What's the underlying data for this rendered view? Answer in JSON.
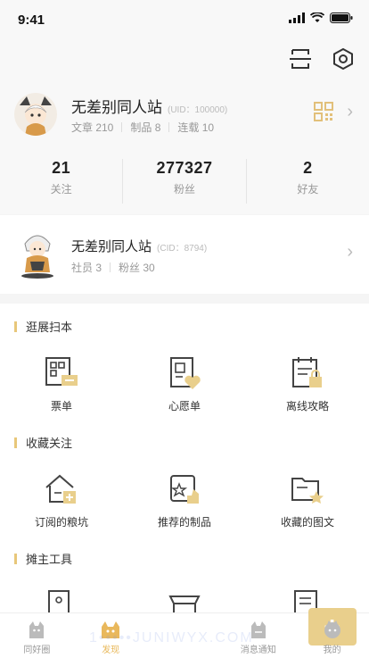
{
  "status_bar": {
    "time": "9:41"
  },
  "profile": {
    "name": "无差别同人站",
    "uid": "(UID：100000)",
    "articles": "文章 210",
    "products": "制品 8",
    "serials": "连载 10"
  },
  "stats": [
    {
      "num": "21",
      "label": "关注"
    },
    {
      "num": "277327",
      "label": "粉丝"
    },
    {
      "num": "2",
      "label": "好友"
    }
  ],
  "circle": {
    "name": "无差别同人站",
    "cid": "(CID：8794)",
    "members": "社员 3",
    "fans": "粉丝 30"
  },
  "sections": [
    {
      "title": "逛展扫本",
      "items": [
        {
          "label": "票单",
          "icon": "ticket-list-icon"
        },
        {
          "label": "心愿单",
          "icon": "wishlist-icon"
        },
        {
          "label": "离线攻略",
          "icon": "offline-guide-icon"
        }
      ]
    },
    {
      "title": "收藏关注",
      "items": [
        {
          "label": "订阅的粮坑",
          "icon": "subscribed-house-icon"
        },
        {
          "label": "推荐的制品",
          "icon": "recommended-product-icon"
        },
        {
          "label": "收藏的图文",
          "icon": "favorite-folder-icon"
        }
      ]
    },
    {
      "title": "摊主工具",
      "items": [
        {
          "label": "",
          "icon": "booth-icon"
        },
        {
          "label": "",
          "icon": "box-icon"
        },
        {
          "label": "",
          "icon": "document-icon"
        }
      ]
    }
  ],
  "tabbar": [
    {
      "label": "同好圈",
      "icon": "cat-icon"
    },
    {
      "label": "发现",
      "icon": "discover-icon"
    },
    {
      "label": "",
      "icon": "plus-icon"
    },
    {
      "label": "消息通知",
      "icon": "message-icon"
    },
    {
      "label": "我的",
      "icon": "me-icon"
    }
  ],
  "watermark": "1•••••JUNIWYX.COM",
  "colors": {
    "accent": "#e8c77a",
    "accent_dark": "#e8b85a"
  }
}
